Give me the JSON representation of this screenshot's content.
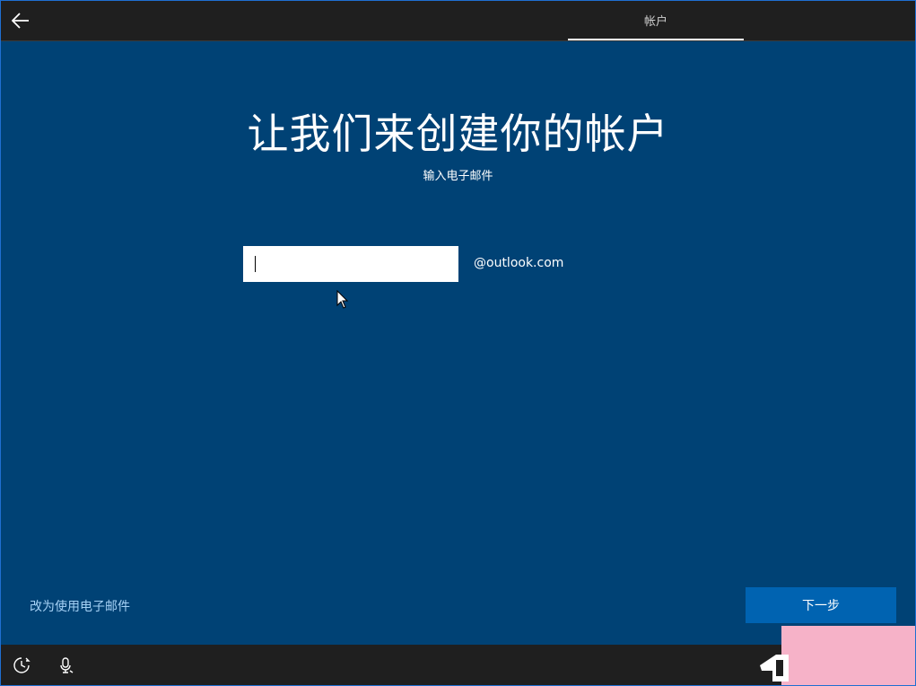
{
  "topbar": {
    "back_icon": "back-arrow-icon",
    "tab_label": "帐户"
  },
  "main": {
    "heading": "让我们来创建你的帐户",
    "subheading": "输入电子邮件",
    "email_input": {
      "value": "",
      "placeholder": ""
    },
    "domain_suffix": "@outlook.com"
  },
  "footer": {
    "alt_link": "改为使用电子邮件",
    "next_button": "下一步"
  },
  "bottombar": {
    "icons": [
      "ease-of-access-icon",
      "microphone-icon"
    ]
  },
  "colors": {
    "background": "#004275",
    "bar": "#1f1f1f",
    "accent": "#0063b1",
    "link": "#a6d1f5"
  }
}
